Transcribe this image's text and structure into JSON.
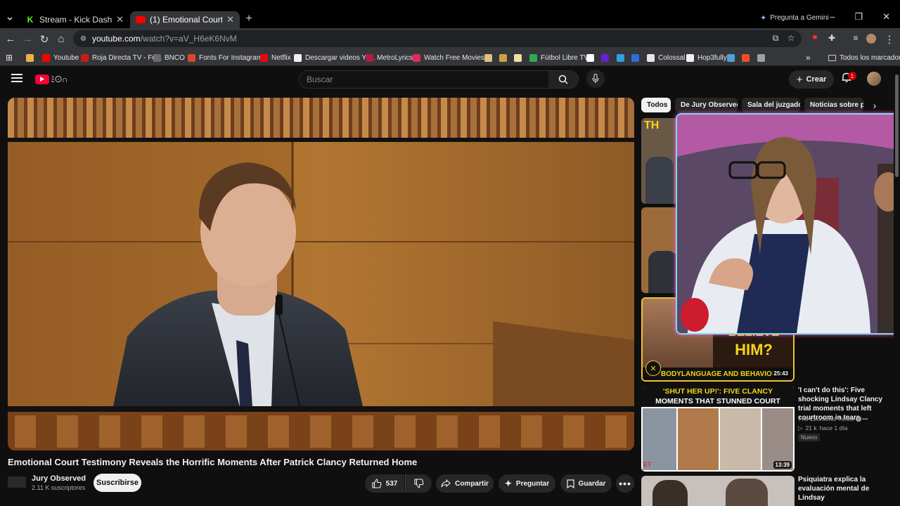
{
  "browser": {
    "tabs": [
      {
        "title": "Stream - Kick Dashboard",
        "favicon_color": "#53fc18"
      },
      {
        "title": "(1) Emotional Court Testimony",
        "favicon_color": "#ff0000"
      }
    ],
    "new_tab_glyph": "+",
    "gemini_label": "Pregunta a Gemini",
    "url_host": "youtube.com",
    "url_path": "/watch?v=aV_H6eK6NvM",
    "bookmarks": [
      {
        "label": "",
        "color": "#e8b24a"
      },
      {
        "label": "Youtube",
        "color": "#ff0000"
      },
      {
        "label": "Roja Directa TV - Fu...",
        "color": "#c21d1d"
      },
      {
        "label": "BNCO",
        "color": "#6b6b6b"
      },
      {
        "label": "Fonts For Instagram...",
        "color": "#d84a2a"
      },
      {
        "label": "Netflix",
        "color": "#e50914"
      },
      {
        "label": "Descargar videos Yo...",
        "color": "#f1f1f1"
      },
      {
        "label": "MetroLyrics",
        "color": "#b01c40"
      },
      {
        "label": "Watch Free Movies...",
        "color": "#e02b5a"
      },
      {
        "label": "",
        "color": "#e0c080"
      },
      {
        "label": "",
        "color": "#d0a040"
      },
      {
        "label": "",
        "color": "#f0e0a0"
      },
      {
        "label": "Fútbol Libre TV",
        "color": "#2fa84f"
      },
      {
        "label": "",
        "color": "#ffffff"
      },
      {
        "label": "",
        "color": "#6a1fd1"
      },
      {
        "label": "",
        "color": "#2fa0e0"
      },
      {
        "label": "",
        "color": "#2b6fd8"
      },
      {
        "label": "Colossal",
        "color": "#e6e6e6"
      },
      {
        "label": "Hop3fully",
        "color": "#f1f1f1"
      },
      {
        "label": "",
        "color": "#4fa0e0"
      },
      {
        "label": "",
        "color": "#f25022"
      },
      {
        "label": "",
        "color": "#9aa0a6"
      }
    ],
    "all_bookmarks": "Todos los marcadores",
    "more_bookmarks": "»"
  },
  "youtube": {
    "search_placeholder": "Buscar",
    "create_label": "Crear",
    "notifications_count": "1",
    "video": {
      "title": "Emotional Court Testimony Reveals the Horrific Moments After Patrick Clancy Returned Home",
      "channel": "Jury Observed",
      "subscribers": "2.11 K suscriptores",
      "subscribe_label": "Suscribirse",
      "likes": "537",
      "share_label": "Compartir",
      "ask_label": "Preguntar",
      "save_label": "Guardar"
    },
    "chips": [
      "Todos",
      "De Jury Observed",
      "Sala del juzgado",
      "Noticias sobre p"
    ],
    "recommendations": [
      {
        "thumb_text_top": "BELIEVE",
        "thumb_text_mid": "HIM?",
        "thumb_text_bottom": "BODYLANGUAGE AND BEHAVIOR",
        "thumb_partial": "TH",
        "duration": "25:43"
      },
      {
        "thumb_text_top": "'SHUT HER UP!': FIVE CLANCY",
        "thumb_text_bottom": "MOMENTS THAT STUNNED COURT",
        "duration": "13:39",
        "title": "'I can't do this': Five shocking Lindsay Clancy trial moments that left courtroom in tears ...",
        "channel": "The Economic Times",
        "views": "21 k",
        "age": "hace 1 día",
        "badge": "Nuevo",
        "logo": "ET"
      },
      {
        "title": "Psiquiatra explica la evaluación mental de Lindsay"
      }
    ]
  }
}
